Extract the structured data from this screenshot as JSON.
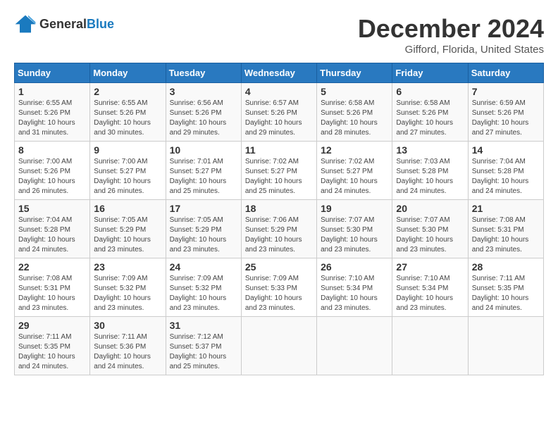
{
  "header": {
    "logo_general": "General",
    "logo_blue": "Blue",
    "month": "December 2024",
    "location": "Gifford, Florida, United States"
  },
  "calendar": {
    "days_of_week": [
      "Sunday",
      "Monday",
      "Tuesday",
      "Wednesday",
      "Thursday",
      "Friday",
      "Saturday"
    ],
    "weeks": [
      [
        null,
        null,
        null,
        null,
        {
          "day": "5",
          "sunrise": "6:58 AM",
          "sunset": "5:26 PM",
          "daylight": "10 hours and 28 minutes."
        },
        {
          "day": "6",
          "sunrise": "6:58 AM",
          "sunset": "5:26 PM",
          "daylight": "10 hours and 27 minutes."
        },
        {
          "day": "7",
          "sunrise": "6:59 AM",
          "sunset": "5:26 PM",
          "daylight": "10 hours and 27 minutes."
        }
      ],
      [
        {
          "day": "1",
          "sunrise": "6:55 AM",
          "sunset": "5:26 PM",
          "daylight": "10 hours and 31 minutes."
        },
        {
          "day": "2",
          "sunrise": "6:55 AM",
          "sunset": "5:26 PM",
          "daylight": "10 hours and 30 minutes."
        },
        {
          "day": "3",
          "sunrise": "6:56 AM",
          "sunset": "5:26 PM",
          "daylight": "10 hours and 29 minutes."
        },
        {
          "day": "4",
          "sunrise": "6:57 AM",
          "sunset": "5:26 PM",
          "daylight": "10 hours and 29 minutes."
        },
        {
          "day": "5",
          "sunrise": "6:58 AM",
          "sunset": "5:26 PM",
          "daylight": "10 hours and 28 minutes."
        },
        {
          "day": "6",
          "sunrise": "6:58 AM",
          "sunset": "5:26 PM",
          "daylight": "10 hours and 27 minutes."
        },
        {
          "day": "7",
          "sunrise": "6:59 AM",
          "sunset": "5:26 PM",
          "daylight": "10 hours and 27 minutes."
        }
      ],
      [
        {
          "day": "8",
          "sunrise": "7:00 AM",
          "sunset": "5:26 PM",
          "daylight": "10 hours and 26 minutes."
        },
        {
          "day": "9",
          "sunrise": "7:00 AM",
          "sunset": "5:27 PM",
          "daylight": "10 hours and 26 minutes."
        },
        {
          "day": "10",
          "sunrise": "7:01 AM",
          "sunset": "5:27 PM",
          "daylight": "10 hours and 25 minutes."
        },
        {
          "day": "11",
          "sunrise": "7:02 AM",
          "sunset": "5:27 PM",
          "daylight": "10 hours and 25 minutes."
        },
        {
          "day": "12",
          "sunrise": "7:02 AM",
          "sunset": "5:27 PM",
          "daylight": "10 hours and 24 minutes."
        },
        {
          "day": "13",
          "sunrise": "7:03 AM",
          "sunset": "5:28 PM",
          "daylight": "10 hours and 24 minutes."
        },
        {
          "day": "14",
          "sunrise": "7:04 AM",
          "sunset": "5:28 PM",
          "daylight": "10 hours and 24 minutes."
        }
      ],
      [
        {
          "day": "15",
          "sunrise": "7:04 AM",
          "sunset": "5:28 PM",
          "daylight": "10 hours and 24 minutes."
        },
        {
          "day": "16",
          "sunrise": "7:05 AM",
          "sunset": "5:29 PM",
          "daylight": "10 hours and 23 minutes."
        },
        {
          "day": "17",
          "sunrise": "7:05 AM",
          "sunset": "5:29 PM",
          "daylight": "10 hours and 23 minutes."
        },
        {
          "day": "18",
          "sunrise": "7:06 AM",
          "sunset": "5:29 PM",
          "daylight": "10 hours and 23 minutes."
        },
        {
          "day": "19",
          "sunrise": "7:07 AM",
          "sunset": "5:30 PM",
          "daylight": "10 hours and 23 minutes."
        },
        {
          "day": "20",
          "sunrise": "7:07 AM",
          "sunset": "5:30 PM",
          "daylight": "10 hours and 23 minutes."
        },
        {
          "day": "21",
          "sunrise": "7:08 AM",
          "sunset": "5:31 PM",
          "daylight": "10 hours and 23 minutes."
        }
      ],
      [
        {
          "day": "22",
          "sunrise": "7:08 AM",
          "sunset": "5:31 PM",
          "daylight": "10 hours and 23 minutes."
        },
        {
          "day": "23",
          "sunrise": "7:09 AM",
          "sunset": "5:32 PM",
          "daylight": "10 hours and 23 minutes."
        },
        {
          "day": "24",
          "sunrise": "7:09 AM",
          "sunset": "5:32 PM",
          "daylight": "10 hours and 23 minutes."
        },
        {
          "day": "25",
          "sunrise": "7:09 AM",
          "sunset": "5:33 PM",
          "daylight": "10 hours and 23 minutes."
        },
        {
          "day": "26",
          "sunrise": "7:10 AM",
          "sunset": "5:34 PM",
          "daylight": "10 hours and 23 minutes."
        },
        {
          "day": "27",
          "sunrise": "7:10 AM",
          "sunset": "5:34 PM",
          "daylight": "10 hours and 23 minutes."
        },
        {
          "day": "28",
          "sunrise": "7:11 AM",
          "sunset": "5:35 PM",
          "daylight": "10 hours and 24 minutes."
        }
      ],
      [
        {
          "day": "29",
          "sunrise": "7:11 AM",
          "sunset": "5:35 PM",
          "daylight": "10 hours and 24 minutes."
        },
        {
          "day": "30",
          "sunrise": "7:11 AM",
          "sunset": "5:36 PM",
          "daylight": "10 hours and 24 minutes."
        },
        {
          "day": "31",
          "sunrise": "7:12 AM",
          "sunset": "5:37 PM",
          "daylight": "10 hours and 25 minutes."
        },
        null,
        null,
        null,
        null
      ]
    ]
  }
}
